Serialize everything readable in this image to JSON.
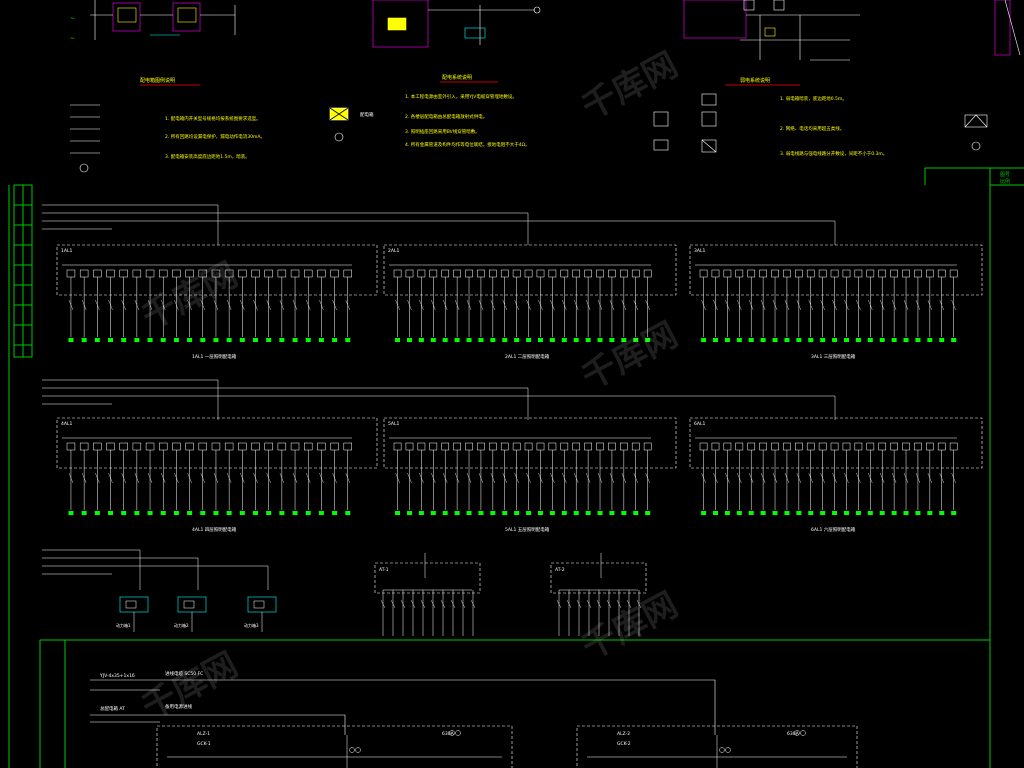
{
  "colors": {
    "background": "#000000",
    "wire": "#ffffff",
    "frame": "#00c800",
    "accent_yellow": "#ffff00",
    "accent_magenta": "#ff00ff",
    "accent_cyan": "#00ffff",
    "terminal_green": "#00ff00"
  },
  "watermark": {
    "text": "千库网"
  },
  "legend_1": {
    "title": "配电箱图例说明",
    "notes": [
      "1. 配电箱内开关型号规格均按系统图要求选型。",
      "2. 所有回路均设漏电保护，漏电动作电流30mA。",
      "3. 配电箱安装高度底边距地1.5m，暗装。"
    ]
  },
  "legend_2": {
    "title": "配电系统说明",
    "symbol_label": "配电箱",
    "notes": [
      "1. 本工程电源由室外引入，采用YJV电缆穿管埋地敷设。",
      "2. 各楼层配电箱由总配电箱放射式供电。",
      "3. 照明插座回路采用BV线穿管暗敷。",
      "4. 所有金属管道及构件均作等电位联结，接地电阻不大于4Ω。"
    ]
  },
  "legend_3": {
    "title": "弱电系统说明",
    "notes": [
      "1. 弱电箱暗装，底边距地0.5m。",
      "2. 网络、电话均采用超五类线。",
      "3. 弱电线路与强电线路分开敷设，间距不小于0.3m。"
    ]
  },
  "title_block": {
    "label_1": "图号",
    "label_2": "比例"
  },
  "panels_row1": [
    {
      "id": "1AL1",
      "caption": "1AL1 一层照明配电箱"
    },
    {
      "id": "2AL1",
      "caption": "2AL1 二层照明配电箱"
    },
    {
      "id": "3AL1",
      "caption": "3AL1 三层照明配电箱"
    }
  ],
  "panels_row2": [
    {
      "id": "4AL1",
      "caption": "4AL1 四层照明配电箱"
    },
    {
      "id": "5AL1",
      "caption": "5AL1 五层照明配电箱"
    },
    {
      "id": "6AL1",
      "caption": "6AL1 六层照明配电箱"
    }
  ],
  "small_boxes": [
    {
      "id": "AP-1",
      "caption": "动力箱1"
    },
    {
      "id": "AP-2",
      "caption": "动力箱2"
    },
    {
      "id": "AP-3",
      "caption": "动力箱3"
    }
  ],
  "feeder_text": {
    "line1": "YJV-4x35+1x16",
    "line2": "进线电缆 SC50 FC",
    "line3": "总配电箱 AT",
    "line4": "备用电源进线"
  },
  "sub_boards": [
    {
      "id": "AT-1",
      "caption": "配电柜1"
    },
    {
      "id": "AT-2",
      "caption": "配电柜2"
    }
  ],
  "bottom_boxes": [
    {
      "id": "ALZ-1",
      "type": "GCK-1",
      "rating": "630A"
    },
    {
      "id": "ALZ-2",
      "type": "GCK-2",
      "rating": "630A"
    }
  ]
}
